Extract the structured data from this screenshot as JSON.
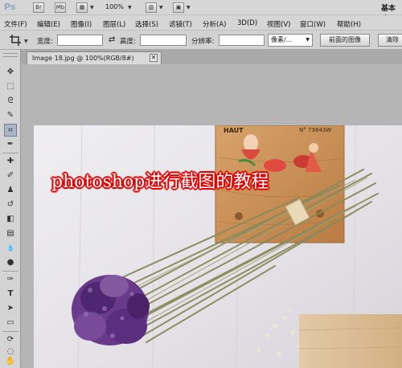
{
  "app": {
    "logo": "Ps",
    "bridge_label": "Br",
    "minibridge_label": "Mb",
    "zoom": "100%",
    "workspace": "基本功"
  },
  "menu": [
    "文件(F)",
    "编辑(E)",
    "图像(I)",
    "图层(L)",
    "选择(S)",
    "滤镜(T)",
    "分析(A)",
    "3D(D)",
    "视图(V)",
    "窗口(W)",
    "帮助(H)"
  ],
  "options": {
    "width_label": "宽度:",
    "height_label": "高度:",
    "resolution_label": "分辨率:",
    "unit_select": "像素/...",
    "front_image_button": "前面的图像",
    "clear_button": "清除",
    "width_value": "",
    "height_value": "",
    "resolution_value": ""
  },
  "document": {
    "tab_label": "Image 18.jpg @ 100%(RGB/8#)",
    "close_glyph": "✕"
  },
  "canvas": {
    "overlay_title": "photoshop进行截图的教程",
    "plaque_text_left": "HAUT",
    "plaque_text_right": "N° 73843W"
  },
  "tools": [
    {
      "name": "move-tool",
      "glyph": "✥"
    },
    {
      "name": "marquee-tool",
      "glyph": "⬚"
    },
    {
      "name": "lasso-tool",
      "glyph": "ᘓ"
    },
    {
      "name": "quick-select-tool",
      "glyph": "✎"
    },
    {
      "name": "crop-tool",
      "glyph": "⌗"
    },
    {
      "name": "eyedropper-tool",
      "glyph": "✒"
    },
    {
      "name": "healing-brush-tool",
      "glyph": "✚"
    },
    {
      "name": "brush-tool",
      "glyph": "✐"
    },
    {
      "name": "clone-stamp-tool",
      "glyph": "♟"
    },
    {
      "name": "history-brush-tool",
      "glyph": "↺"
    },
    {
      "name": "eraser-tool",
      "glyph": "◧"
    },
    {
      "name": "gradient-tool",
      "glyph": "▤"
    },
    {
      "name": "blur-tool",
      "glyph": "💧"
    },
    {
      "name": "dodge-tool",
      "glyph": "●"
    },
    {
      "name": "pen-tool",
      "glyph": "✑"
    },
    {
      "name": "type-tool",
      "glyph": "T"
    },
    {
      "name": "path-select-tool",
      "glyph": "➤"
    },
    {
      "name": "shape-tool",
      "glyph": "▭"
    },
    {
      "name": "3d-rotate-tool",
      "glyph": "⟳"
    },
    {
      "name": "3d-orbit-tool",
      "glyph": "◌"
    },
    {
      "name": "hand-tool",
      "glyph": "✋"
    }
  ],
  "colors": {
    "overlay_stroke": "#e10000",
    "active_tool_bg": "#a9b6c6"
  }
}
